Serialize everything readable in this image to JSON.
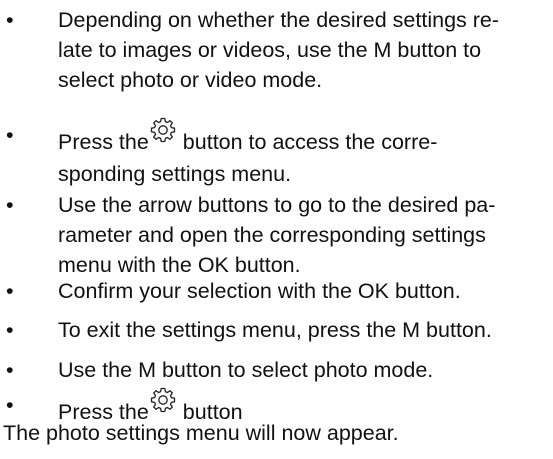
{
  "bullets": [
    {
      "lines": [
        "Depending on whether the desired settings re-",
        "late to images or videos, use the M button to",
        "select photo or video mode."
      ]
    },
    {
      "before_icon": "Press the",
      "icon": "settings-gear-icon",
      "after_icon": " button to access the corre-",
      "lines": [
        "sponding settings menu."
      ]
    },
    {
      "lines": [
        "Use the arrow buttons to go to the desired pa-",
        "rameter and open the corresponding settings",
        "menu with the OK button."
      ]
    },
    {
      "lines": [
        "Confirm your selection with the OK button."
      ]
    },
    {
      "lines": [
        "To exit the settings menu, press the M button."
      ]
    },
    {
      "lines": [
        "Use the M button to select photo mode."
      ]
    },
    {
      "before_icon": "Press the",
      "icon": "settings-gear-icon",
      "after_icon": " button"
    }
  ],
  "bullet_symbol": "•",
  "footer": "The photo settings menu will now appear."
}
